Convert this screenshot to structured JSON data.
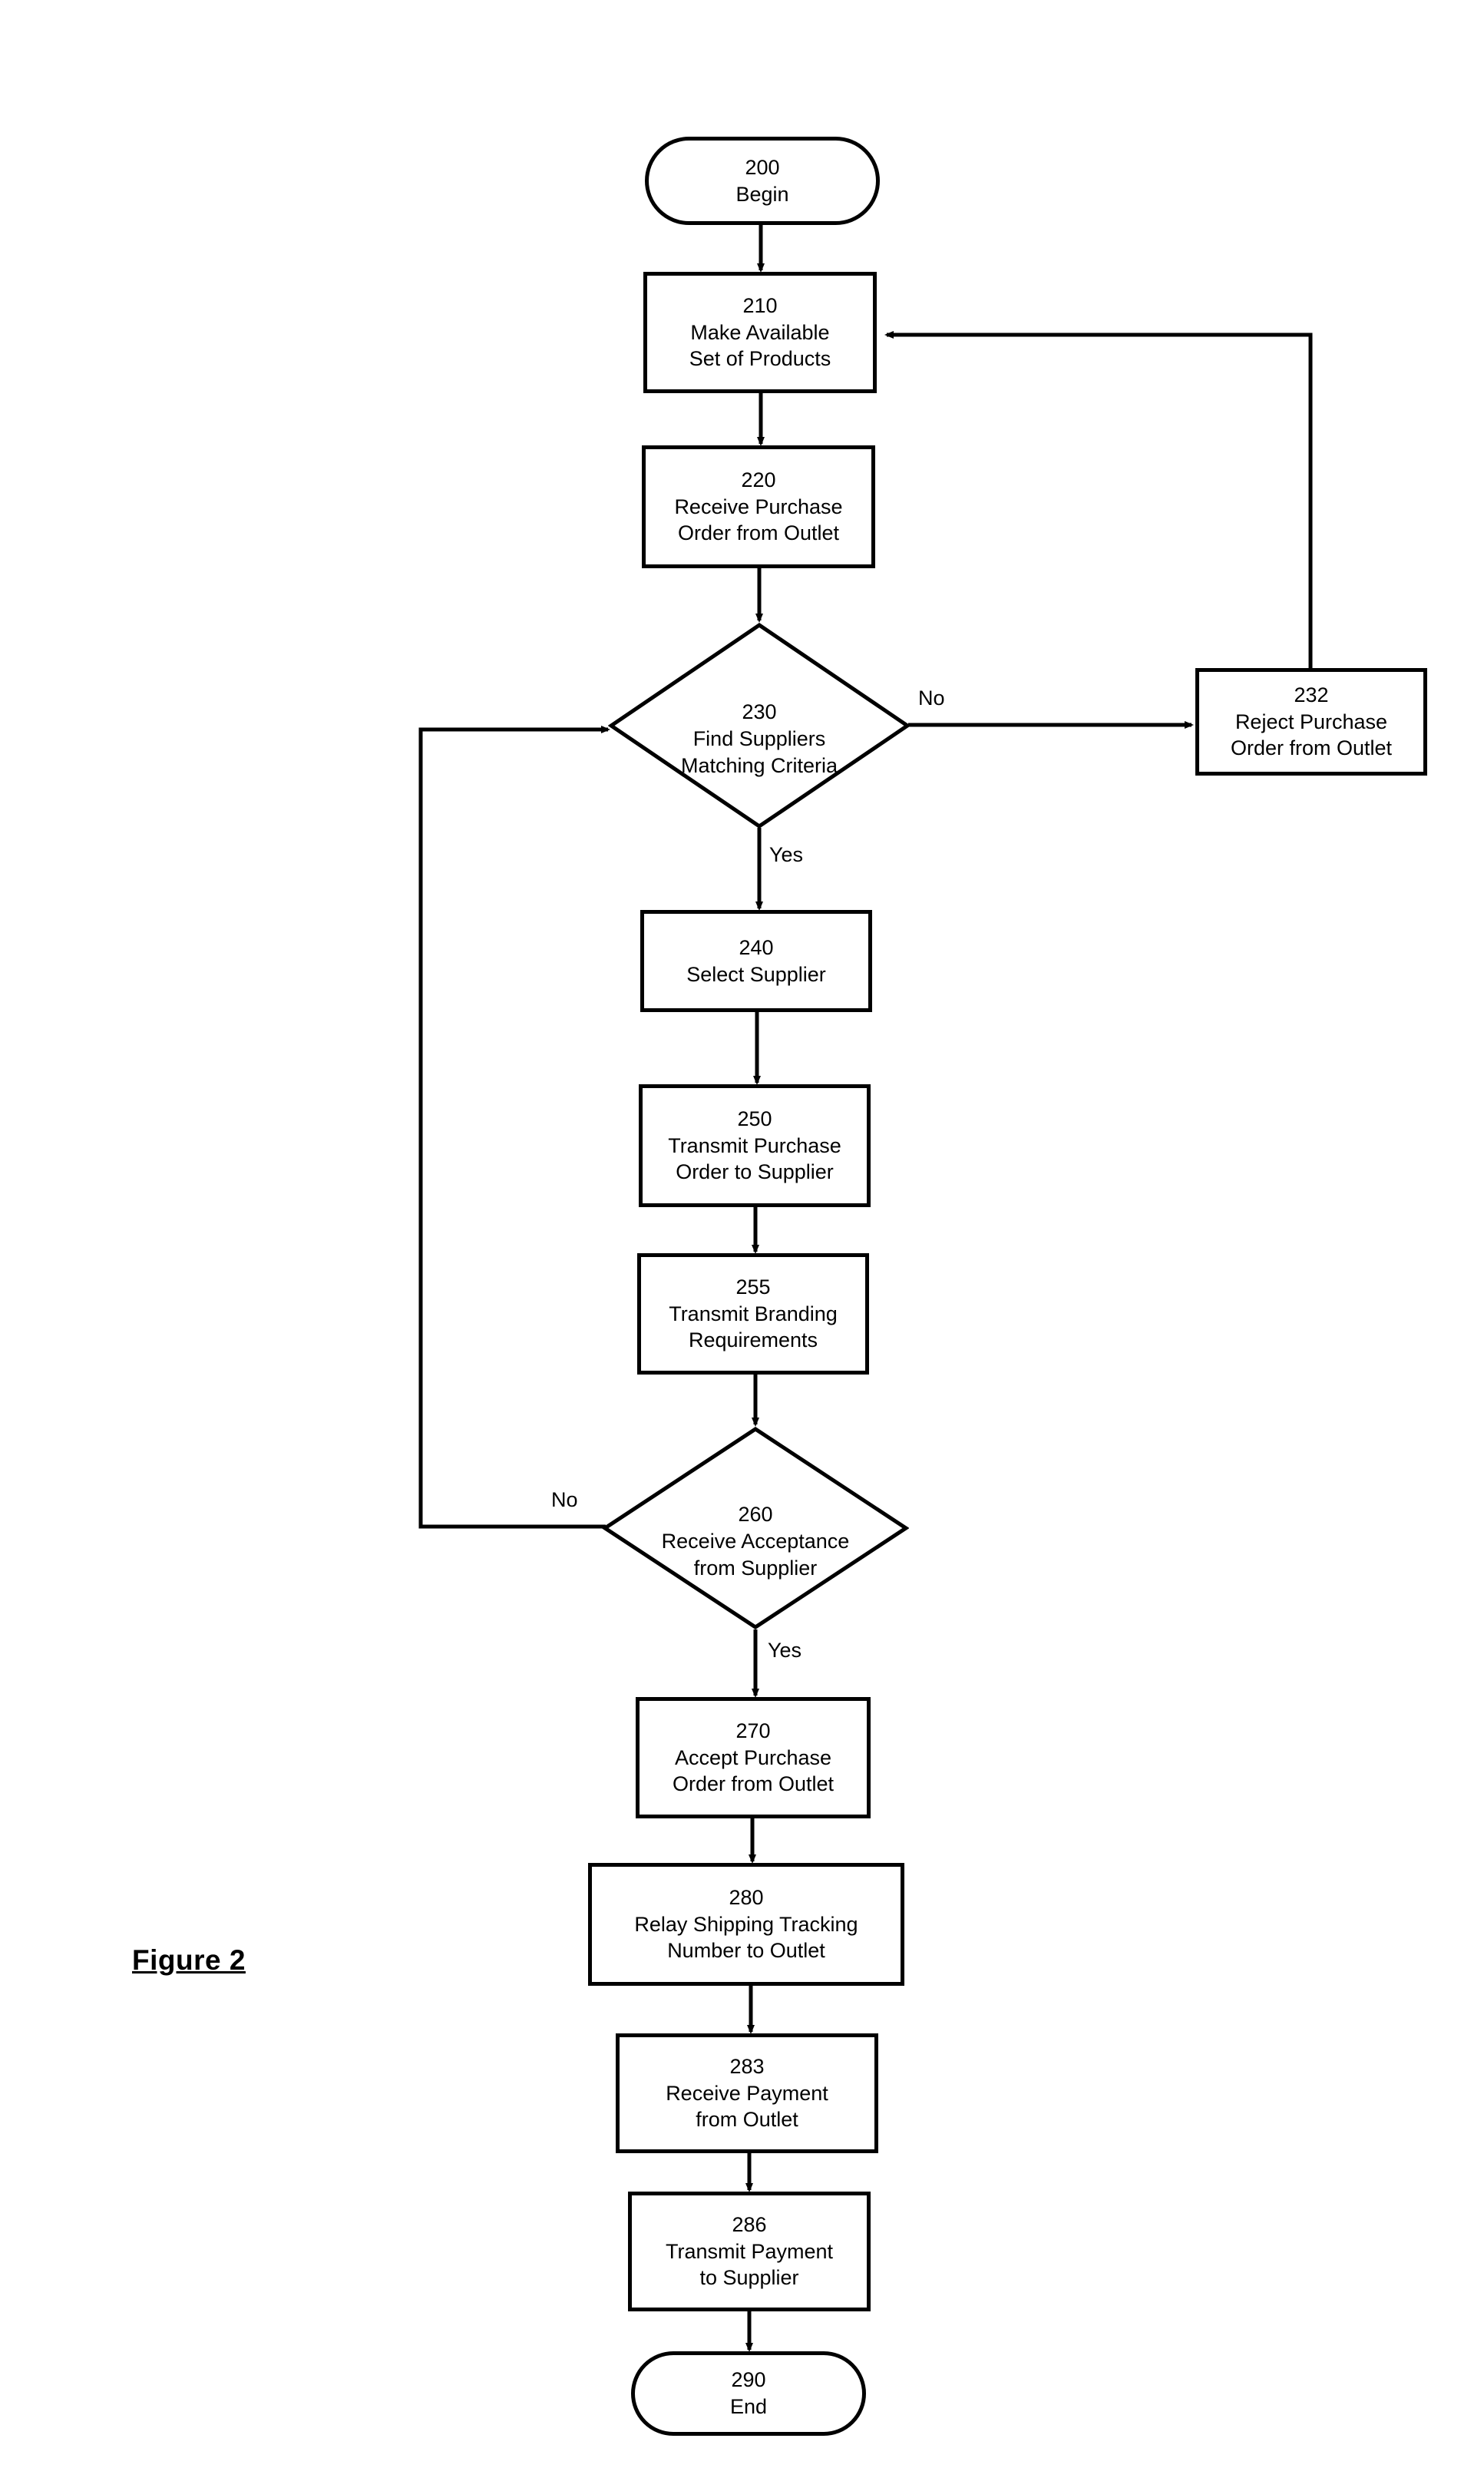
{
  "figure": {
    "caption": "Figure 2"
  },
  "nodes": [
    {
      "id": "200",
      "number": "200",
      "label": "Begin",
      "shape": "terminator"
    },
    {
      "id": "210",
      "number": "210",
      "label": "Make Available\nSet of Products",
      "shape": "process"
    },
    {
      "id": "220",
      "number": "220",
      "label": "Receive Purchase\nOrder from Outlet",
      "shape": "process"
    },
    {
      "id": "230",
      "number": "230",
      "label": "Find Suppliers\nMatching Criteria",
      "shape": "decision"
    },
    {
      "id": "232",
      "number": "232",
      "label": "Reject Purchase\nOrder from Outlet",
      "shape": "process"
    },
    {
      "id": "240",
      "number": "240",
      "label": "Select Supplier",
      "shape": "process"
    },
    {
      "id": "250",
      "number": "250",
      "label": "Transmit Purchase\nOrder to Supplier",
      "shape": "process"
    },
    {
      "id": "255",
      "number": "255",
      "label": "Transmit Branding\nRequirements",
      "shape": "process"
    },
    {
      "id": "260",
      "number": "260",
      "label": "Receive Acceptance\nfrom Supplier",
      "shape": "decision"
    },
    {
      "id": "270",
      "number": "270",
      "label": "Accept Purchase\nOrder from Outlet",
      "shape": "process"
    },
    {
      "id": "280",
      "number": "280",
      "label": "Relay Shipping Tracking\nNumber to Outlet",
      "shape": "process"
    },
    {
      "id": "283",
      "number": "283",
      "label": "Receive Payment\nfrom Outlet",
      "shape": "process"
    },
    {
      "id": "286",
      "number": "286",
      "label": "Transmit Payment\nto Supplier",
      "shape": "process"
    },
    {
      "id": "290",
      "number": "290",
      "label": "End",
      "shape": "terminator"
    }
  ],
  "edge_labels": {
    "d230_no": "No",
    "d230_yes": "Yes",
    "d260_no": "No",
    "d260_yes": "Yes"
  },
  "colors": {
    "stroke": "#000000",
    "fill": "#ffffff",
    "text": "#000000"
  }
}
